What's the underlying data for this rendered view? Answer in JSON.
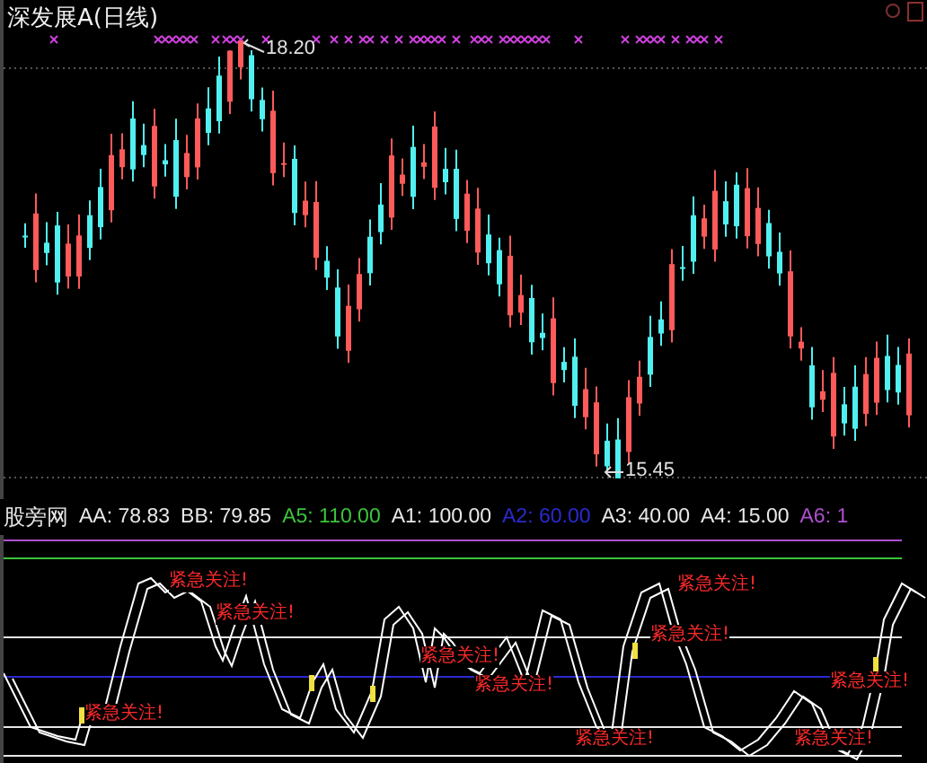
{
  "title": "深发展A(日线)",
  "price_chart": {
    "high_label": "18.20",
    "low_label": "15.45"
  },
  "indicator": {
    "name": "股旁网",
    "values": [
      {
        "label": "AA:",
        "value": "78.83",
        "color": "#e8e8e8"
      },
      {
        "label": "BB:",
        "value": "79.85",
        "color": "#e8e8e8"
      },
      {
        "label": "A5:",
        "value": "110.00",
        "color": "#3cc43c"
      },
      {
        "label": "A1:",
        "value": "100.00",
        "color": "#e8e8e8"
      },
      {
        "label": "A2:",
        "value": "60.00",
        "color": "#2a2ad0"
      },
      {
        "label": "A3:",
        "value": "40.00",
        "color": "#e8e8e8"
      },
      {
        "label": "A4:",
        "value": "15.00",
        "color": "#e8e8e8"
      },
      {
        "label": "A6:",
        "value": "1",
        "color": "#b050d0"
      }
    ]
  },
  "alerts": [
    {
      "text": "紧急关注!"
    },
    {
      "text": "紧急关注!"
    },
    {
      "text": "紧急关注!"
    },
    {
      "text": "紧急关注!"
    },
    {
      "text": "紧急关注!"
    },
    {
      "text": "紧急关注!"
    },
    {
      "text": "紧急关注!"
    },
    {
      "text": "紧急关注!"
    },
    {
      "text": "紧急关注!"
    },
    {
      "text": "紧急关注!"
    }
  ]
}
